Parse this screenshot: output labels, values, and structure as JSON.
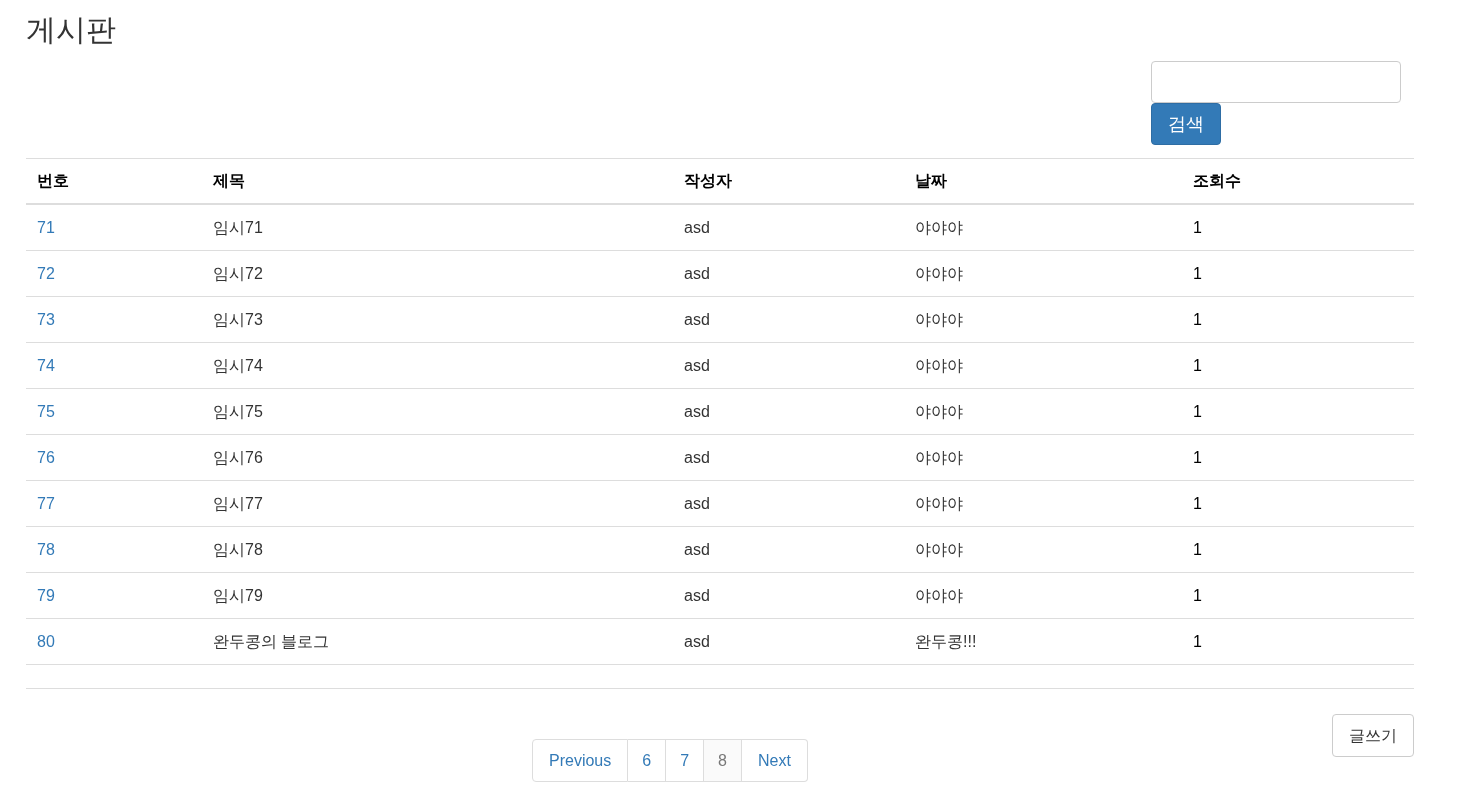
{
  "title": "게시판",
  "search": {
    "button": "검색"
  },
  "table": {
    "columns": [
      "번호",
      "제목",
      "작성자",
      "날짜",
      "조회수"
    ],
    "rows": [
      [
        "71",
        "임시71",
        "asd",
        "야야야",
        "1"
      ],
      [
        "72",
        "임시72",
        "asd",
        "야야야",
        "1"
      ],
      [
        "73",
        "임시73",
        "asd",
        "야야야",
        "1"
      ],
      [
        "74",
        "임시74",
        "asd",
        "야야야",
        "1"
      ],
      [
        "75",
        "임시75",
        "asd",
        "야야야",
        "1"
      ],
      [
        "76",
        "임시76",
        "asd",
        "야야야",
        "1"
      ],
      [
        "77",
        "임시77",
        "asd",
        "야야야",
        "1"
      ],
      [
        "78",
        "임시78",
        "asd",
        "야야야",
        "1"
      ],
      [
        "79",
        "임시79",
        "asd",
        "야야야",
        "1"
      ],
      [
        "80",
        "완두콩의 블로그",
        "asd",
        "완두콩!!!",
        "1"
      ]
    ]
  },
  "write_button": "글쓰기",
  "pagination": {
    "previous": "Previous",
    "next": "Next",
    "pages": [
      {
        "label": "6",
        "selected": false
      },
      {
        "label": "7",
        "selected": false
      },
      {
        "label": "8",
        "selected": true
      }
    ]
  }
}
